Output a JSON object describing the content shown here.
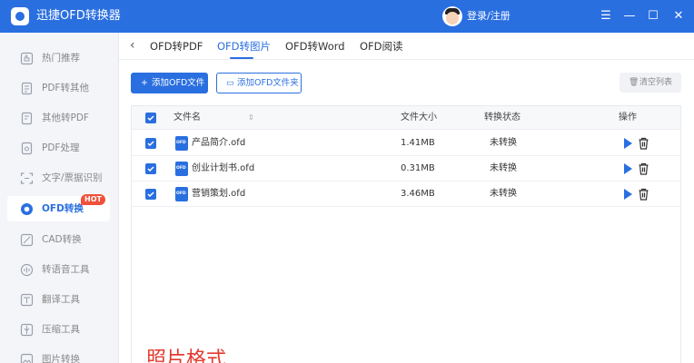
{
  "app": {
    "title": "迅捷OFD转换器",
    "login": "登录/注册"
  },
  "window_controls": {
    "menu": "☰",
    "minimize": "—",
    "maximize": "☐",
    "close": "✕"
  },
  "sidebar": {
    "items": [
      {
        "label": "热门推荐",
        "icon": "thumb-up-icon"
      },
      {
        "label": "PDF转其他",
        "icon": "pdf-doc-icon"
      },
      {
        "label": "其他转PDF",
        "icon": "doc-to-pdf-icon"
      },
      {
        "label": "PDF处理",
        "icon": "pdf-tool-icon"
      },
      {
        "label": "文字/票据识别",
        "icon": "ocr-icon"
      },
      {
        "label": "OFD转换",
        "icon": "ofd-icon",
        "badge": "HOT",
        "active": true
      },
      {
        "label": "CAD转换",
        "icon": "cad-icon"
      },
      {
        "label": "转语音工具",
        "icon": "audio-icon"
      },
      {
        "label": "翻译工具",
        "icon": "translate-icon"
      },
      {
        "label": "压缩工具",
        "icon": "compress-icon"
      },
      {
        "label": "图片转换",
        "icon": "image-icon"
      }
    ]
  },
  "tabs": [
    "OFD转PDF",
    "OFD转图片",
    "OFD转Word",
    "OFD阅读"
  ],
  "toolbar": {
    "add_file": "添加OFD文件",
    "add_folder": "添加OFD文件夹",
    "clear_list": "清空列表"
  },
  "table": {
    "headers": {
      "name": "文件名",
      "size": "文件大小",
      "status": "转换状态",
      "action": "操作"
    },
    "rows": [
      {
        "name": "产品简介.ofd",
        "size": "1.41MB",
        "status": "未转换"
      },
      {
        "name": "创业计划书.ofd",
        "size": "0.31MB",
        "status": "未转换"
      },
      {
        "name": "营销策划.ofd",
        "size": "3.46MB",
        "status": "未转换"
      }
    ]
  },
  "watermark_text": "照片格式",
  "colors": {
    "primary": "#2a6fe0",
    "hot": "#f0513a",
    "watermark": "#e23b2e"
  }
}
